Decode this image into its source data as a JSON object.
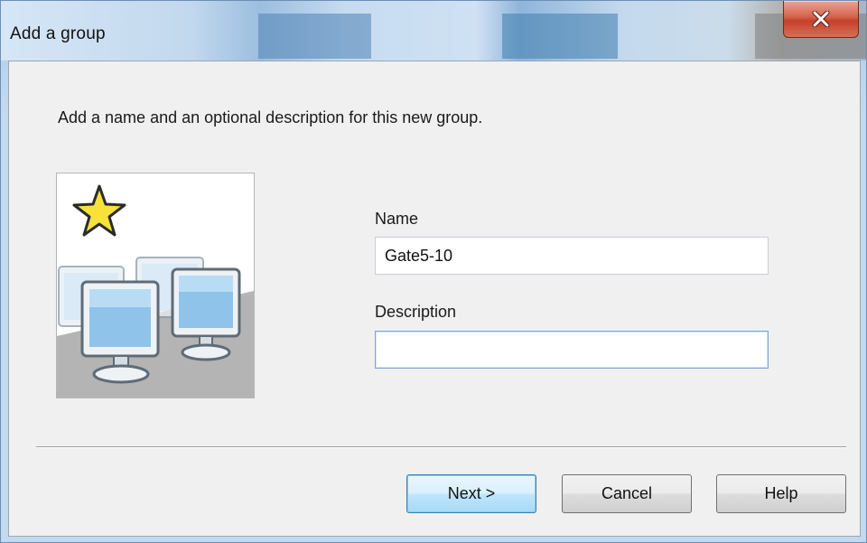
{
  "window": {
    "title": "Add a group"
  },
  "dialog": {
    "instruction": "Add a name and an optional description for this new group.",
    "name_label": "Name",
    "name_value": "Gate5-10",
    "description_label": "Description",
    "description_value": ""
  },
  "buttons": {
    "next_label": "Next >",
    "cancel_label": "Cancel",
    "help_label": "Help"
  },
  "icons": {
    "close": "close-icon",
    "illustration": "group-of-computers-with-star-icon"
  },
  "colors": {
    "close_button": "#c4412b",
    "default_button_border": "#3c7fb1",
    "dialog_background": "#f0f0f0"
  }
}
